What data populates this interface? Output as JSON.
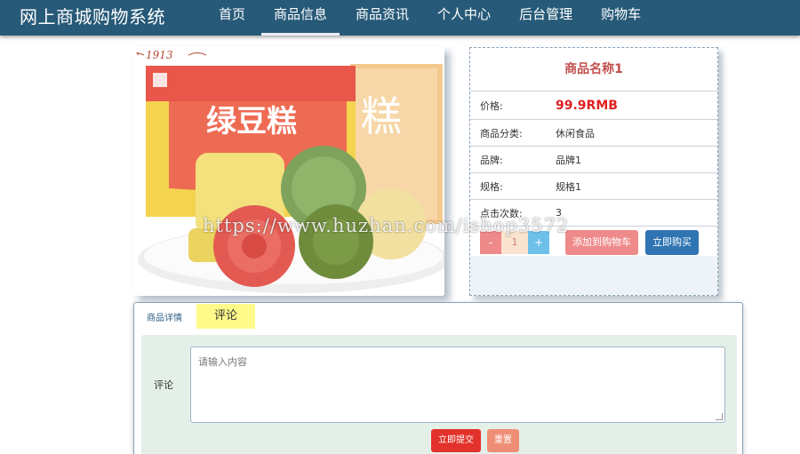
{
  "header": {
    "brand": "网上商城购物系统",
    "nav": [
      "首页",
      "商品信息",
      "商品资讯",
      "个人中心",
      "后台管理",
      "购物车"
    ],
    "active_nav": "商品信息"
  },
  "product": {
    "name": "商品名称1",
    "price_label": "价格:",
    "price": "99.9RMB",
    "category_label": "商品分类:",
    "category": "休闲食品",
    "brand_label": "品牌:",
    "brand": "品牌1",
    "spec_label": "规格:",
    "spec": "规格1",
    "clicks_label": "点击次数:",
    "clicks": "3",
    "image_year": "1913",
    "image_box_text": "绿豆糕",
    "quantity": {
      "minus": "-",
      "value": "1",
      "plus": "+"
    },
    "add_to_cart": "添加到购物车",
    "buy_now": "立即购买"
  },
  "tabs": {
    "detail": "商品详情",
    "comment": "评论"
  },
  "comment": {
    "label": "评论",
    "placeholder": "请输入内容",
    "submit": "立即提交",
    "reset": "重置"
  },
  "watermark": "https://www.huzhan.com/ishop3572",
  "colors": {
    "header_bg": "#275a78",
    "price": "#e02020",
    "title": "#c0504d",
    "buy_button": "#2f74b3",
    "submit": "#e2322b"
  }
}
